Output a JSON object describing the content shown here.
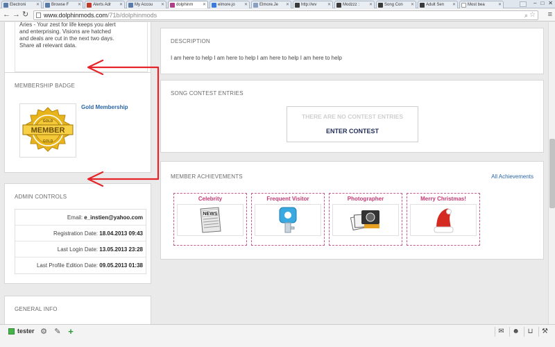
{
  "browser": {
    "tabs": [
      {
        "label": "Electroni"
      },
      {
        "label": "Browse F"
      },
      {
        "label": "Alerts Adr"
      },
      {
        "label": "My Accou"
      },
      {
        "label": "dolphinm"
      },
      {
        "label": "elmore.jo"
      },
      {
        "label": "Elmore.Je"
      },
      {
        "label": "http://wv"
      },
      {
        "label": "Modzzz :"
      },
      {
        "label": "Song Con"
      },
      {
        "label": "Adult Sen"
      },
      {
        "label": "Most bea"
      }
    ],
    "active_tab_index": 4,
    "url_host": "www.dolphinmods.com",
    "url_path": "/71b/dolphinmods",
    "icons": {
      "back": "back-arrow-icon",
      "forward": "forward-arrow-icon",
      "reload": "reload-icon",
      "star": "bookmark-star-icon",
      "menu": "hamburger-menu-icon"
    }
  },
  "sidebar": {
    "zodiac_text": [
      "Aries - Your zest for life keeps you alert",
      "and enterprising. Visions are hatched",
      "and deals are cut in the next two days.",
      "Share all relevant data."
    ],
    "badge": {
      "title": "MEMBERSHIP BADGE",
      "link": "Gold Membership",
      "image_text_top": "GOLD",
      "image_text_main": "MEMBER",
      "image_text_bottom": "GOLD"
    },
    "admin": {
      "title": "ADMIN CONTROLS",
      "rows": [
        {
          "label": "Email:",
          "value": "e_instien@yahoo.com"
        },
        {
          "label": "Registration Date:",
          "value": "18.04.2013 09:43"
        },
        {
          "label": "Last Login Date:",
          "value": "13.05.2013 23:28"
        },
        {
          "label": "Last Profile Edition Date:",
          "value": "09.05.2013 01:38"
        }
      ]
    },
    "general": {
      "title": "GENERAL INFO"
    }
  },
  "main": {
    "description": {
      "title": "DESCRIPTION",
      "text": "I am here to help I am here to help I am here to help I am here to help"
    },
    "contest": {
      "title": "SONG CONTEST ENTRIES",
      "none_text": "THERE ARE NO CONTEST ENTRIES",
      "enter_label": "ENTER CONTEST"
    },
    "achievements": {
      "title": "MEMBER ACHIEVEMENTS",
      "all_link": "All Achievements",
      "items": [
        {
          "label": "Celebrity",
          "icon": "newspaper-icon"
        },
        {
          "label": "Frequent Visitor",
          "icon": "key-icon"
        },
        {
          "label": "Photographer",
          "icon": "camera-photos-icon"
        },
        {
          "label": "Merry Christmas!",
          "icon": "santa-hat-icon"
        }
      ]
    }
  },
  "taskbar": {
    "username": "tester",
    "icons": [
      "gear-icon",
      "edit-icon",
      "add-icon",
      "mail-icon",
      "user-icon",
      "cart-icon",
      "wrench-icon"
    ]
  },
  "colors": {
    "link": "#2b65a7",
    "achievement_label": "#c23a73",
    "online": "#46b34b",
    "annotation_arrow": "#e5252a",
    "badge_gold": "#e7b51b"
  }
}
